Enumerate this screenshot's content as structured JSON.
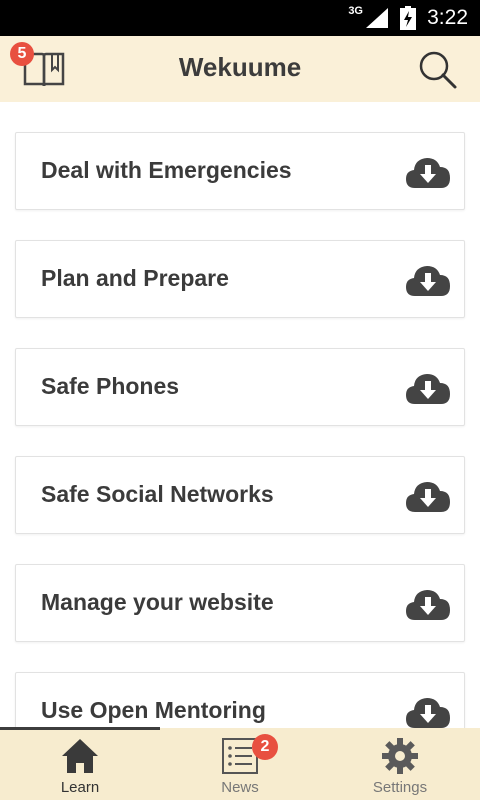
{
  "status_bar": {
    "network": "3G",
    "time": "3:22"
  },
  "header": {
    "title": "Wekuume",
    "bookmarks_badge": "5"
  },
  "cards": [
    {
      "label": "Deal with Emergencies"
    },
    {
      "label": "Plan and Prepare"
    },
    {
      "label": "Safe Phones"
    },
    {
      "label": "Safe Social Networks"
    },
    {
      "label": "Manage your website"
    },
    {
      "label": "Use Open Mentoring"
    }
  ],
  "tabs": [
    {
      "label": "Learn",
      "icon": "home-icon"
    },
    {
      "label": "News",
      "icon": "news-list-icon",
      "badge": "2"
    },
    {
      "label": "Settings",
      "icon": "gear-icon"
    }
  ],
  "colors": {
    "header_bg": "#faf0d8",
    "tab_bg": "#f7eccf",
    "badge": "#e85040",
    "text_dark": "#3b3b3b"
  }
}
